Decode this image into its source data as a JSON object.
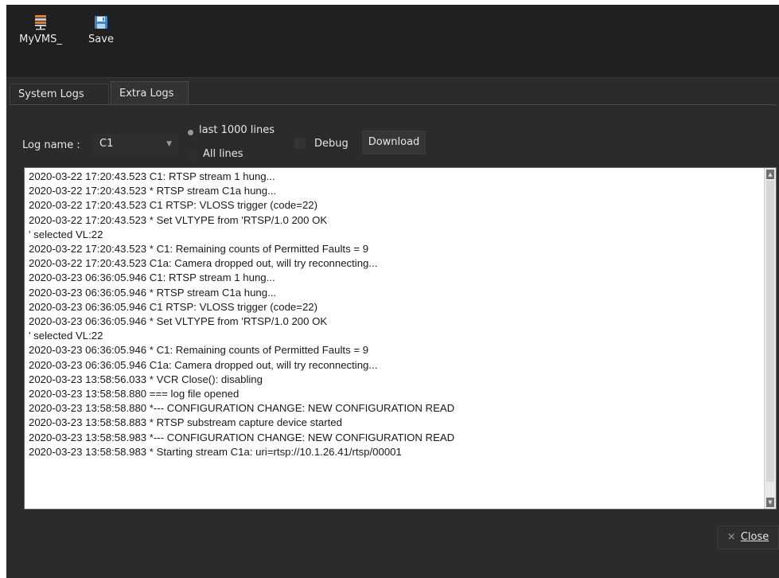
{
  "toolbar": {
    "myvms": {
      "label": "MyVMS_",
      "icon": "server-icon"
    },
    "save": {
      "label": "Save",
      "icon": "floppy-disk-icon"
    }
  },
  "tabs": [
    {
      "label": "System Logs",
      "active": false
    },
    {
      "label": "Extra Logs",
      "active": true
    }
  ],
  "controls": {
    "log_name_label": "Log name :",
    "log_name_value": "C1",
    "radio_last_label": "last 1000 lines",
    "radio_last_selected": true,
    "radio_all_label": "All lines",
    "radio_all_selected": false,
    "debug_label": "Debug",
    "debug_checked": false,
    "download_label": "Download"
  },
  "log_lines": [
    "2020-03-22 17:20:43.523 C1: RTSP stream 1 hung...",
    "2020-03-22 17:20:43.523 * RTSP stream C1a hung...",
    "2020-03-22 17:20:43.523 C1 RTSP: VLOSS trigger (code=22)",
    "2020-03-22 17:20:43.523 * Set VLTYPE from 'RTSP/1.0 200 OK",
    "' selected VL:22",
    "2020-03-22 17:20:43.523 * C1: Remaining counts of Permitted Faults = 9",
    "2020-03-22 17:20:43.523 C1a: Camera dropped out, will try reconnecting...",
    "2020-03-23 06:36:05.946 C1: RTSP stream 1 hung...",
    "2020-03-23 06:36:05.946 * RTSP stream C1a hung...",
    "2020-03-23 06:36:05.946 C1 RTSP: VLOSS trigger (code=22)",
    "2020-03-23 06:36:05.946 * Set VLTYPE from 'RTSP/1.0 200 OK",
    "' selected VL:22",
    "2020-03-23 06:36:05.946 * C1: Remaining counts of Permitted Faults = 9",
    "2020-03-23 06:36:05.946 C1a: Camera dropped out, will try reconnecting...",
    "2020-03-23 13:58:56.033 * VCR Close(): disabling",
    "2020-03-23 13:58:58.880 === log file opened",
    "2020-03-23 13:58:58.880 *--- CONFIGURATION CHANGE: NEW CONFIGURATION READ",
    "2020-03-23 13:58:58.883 * RTSP substream capture device started",
    "2020-03-23 13:58:58.983 *--- CONFIGURATION CHANGE: NEW CONFIGURATION READ",
    "2020-03-23 13:58:58.983 * Starting stream C1a: uri=rtsp://10.1.26.41/rtsp/00001"
  ],
  "close": {
    "symbol": "×",
    "label": "Close"
  },
  "colors": {
    "window_bg": "#2b2b2b",
    "toolbar_bg": "#202020",
    "log_bg": "#ffffff",
    "text_light": "#e6e6e6"
  }
}
